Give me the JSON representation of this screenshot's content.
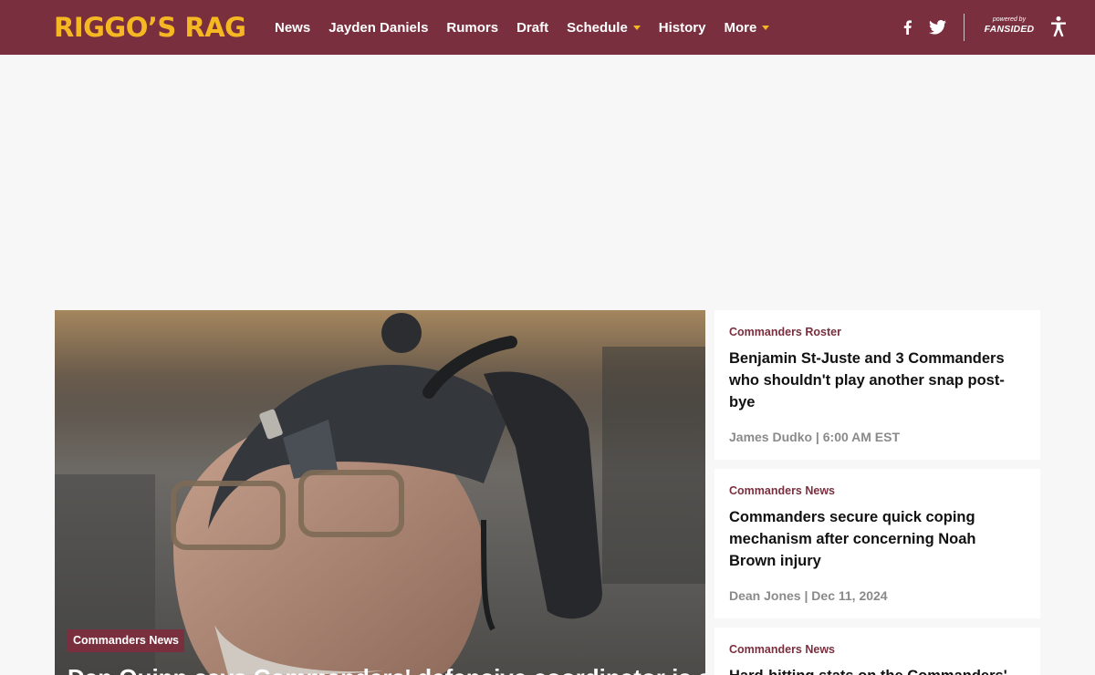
{
  "header": {
    "logo_text": "RIGGO’S RAG",
    "nav": [
      {
        "label": "News",
        "dropdown": false
      },
      {
        "label": "Jayden Daniels",
        "dropdown": false
      },
      {
        "label": "Rumors",
        "dropdown": false
      },
      {
        "label": "Draft",
        "dropdown": false
      },
      {
        "label": "Schedule",
        "dropdown": true
      },
      {
        "label": "History",
        "dropdown": false
      },
      {
        "label": "More",
        "dropdown": true
      }
    ],
    "social_icons": [
      "facebook-icon",
      "twitter-icon"
    ],
    "powered_by": "powered by",
    "fansided": "FANSIDED",
    "accessibility_icon": "accessibility-icon"
  },
  "hero": {
    "category": "Commanders News",
    "title": "Dan Quinn says Commanders' defensive coordinator is safe"
  },
  "sidebar": {
    "articles": [
      {
        "category": "Commanders Roster",
        "title": "Benjamin St-Juste and 3 Commanders who shouldn't play another snap post-bye",
        "author": "James Dudko",
        "date": "6:00 AM EST"
      },
      {
        "category": "Commanders News",
        "title": "Commanders secure quick coping mechanism after concerning Noah Brown injury",
        "author": "Dean Jones",
        "date": "Dec 11, 2024"
      },
      {
        "category": "Commanders News",
        "title": "Hard-hitting stats on the Commanders' defense",
        "author": "",
        "date": ""
      }
    ]
  },
  "colors": {
    "brand": "#7a2f3e",
    "accent": "#f5b722",
    "meta": "#8a8a8a"
  }
}
